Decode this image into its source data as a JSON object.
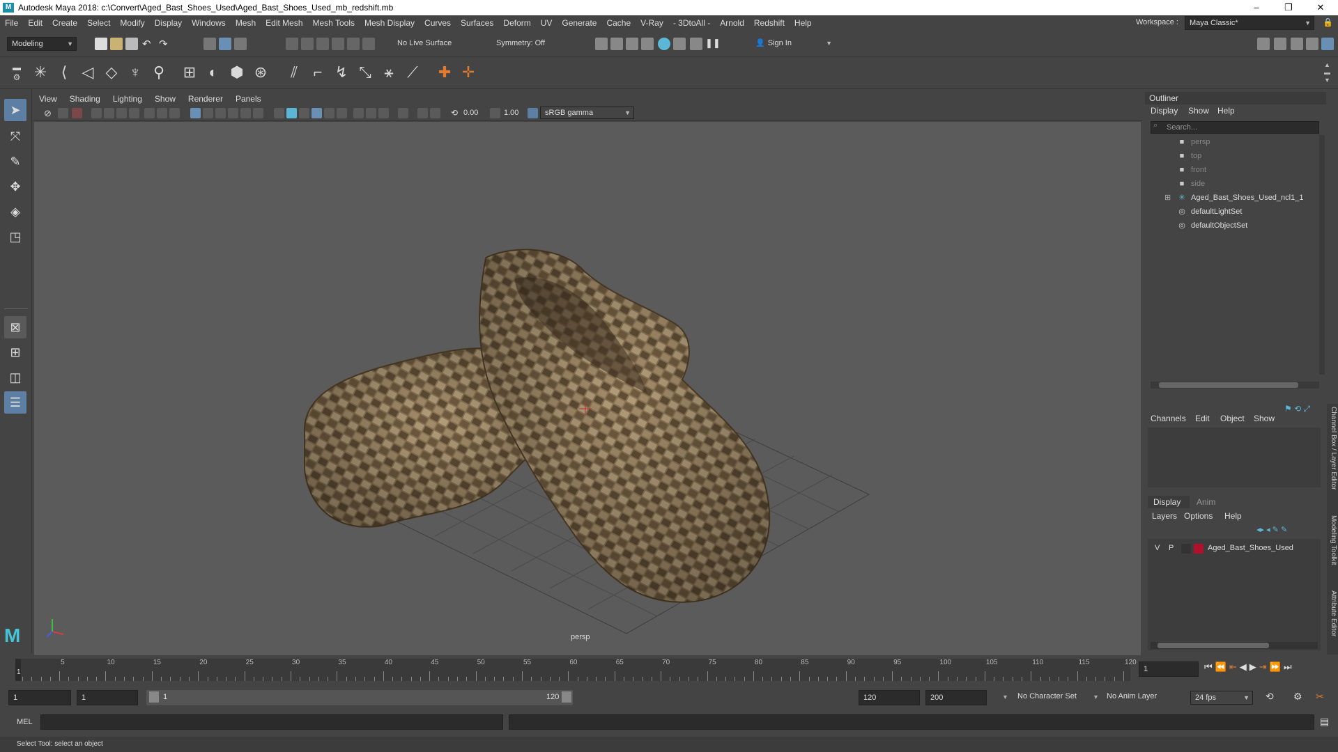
{
  "title": "Autodesk Maya 2018: c:\\Convert\\Aged_Bast_Shoes_Used\\Aged_Bast_Shoes_Used_mb_redshift.mb",
  "window_controls": [
    "–",
    "❐",
    "✕"
  ],
  "menu": [
    "File",
    "Edit",
    "Create",
    "Select",
    "Modify",
    "Display",
    "Windows",
    "Mesh",
    "Edit Mesh",
    "Mesh Tools",
    "Mesh Display",
    "Curves",
    "Surfaces",
    "Deform",
    "UV",
    "Generate",
    "Cache",
    "V-Ray",
    "- 3DtoAll -",
    "Arnold",
    "Redshift",
    "Help"
  ],
  "workspace": {
    "label": "Workspace :",
    "value": "Maya Classic*"
  },
  "status": {
    "mode": "Modeling",
    "live_surface": "No Live Surface",
    "symmetry": "Symmetry: Off",
    "sign_in": "Sign In"
  },
  "viewport": {
    "menu": [
      "View",
      "Shading",
      "Lighting",
      "Show",
      "Renderer",
      "Panels"
    ],
    "exposure": "0.00",
    "gamma": "1.00",
    "color_space": "sRGB gamma",
    "camera_label": "persp"
  },
  "outliner": {
    "title": "Outliner",
    "menu": [
      "Display",
      "Show",
      "Help"
    ],
    "search_placeholder": "Search...",
    "items": [
      {
        "label": "persp",
        "icon": "camera-icon",
        "dim": true
      },
      {
        "label": "top",
        "icon": "camera-icon",
        "dim": true
      },
      {
        "label": "front",
        "icon": "camera-icon",
        "dim": true
      },
      {
        "label": "side",
        "icon": "camera-icon",
        "dim": true
      },
      {
        "label": "Aged_Bast_Shoes_Used_ncl1_1",
        "icon": "transform-icon",
        "dim": false,
        "expandable": true
      },
      {
        "label": "defaultLightSet",
        "icon": "set-icon",
        "dim": false
      },
      {
        "label": "defaultObjectSet",
        "icon": "set-icon",
        "dim": false
      }
    ]
  },
  "channel_box": {
    "menu": [
      "Channels",
      "Edit",
      "Object",
      "Show"
    ]
  },
  "layer_editor": {
    "tabs": [
      "Display",
      "Anim"
    ],
    "menu": [
      "Layers",
      "Options",
      "Help"
    ],
    "layer": {
      "v": "V",
      "p": "P",
      "name": "Aged_Bast_Shoes_Used",
      "color": "#b0102a"
    }
  },
  "side_tabs": [
    "Channel Box / Layer Editor",
    "Modeling Toolkit",
    "Attribute Editor"
  ],
  "timeline": {
    "labels": [
      "5",
      "10",
      "15",
      "20",
      "25",
      "30",
      "35",
      "40",
      "45",
      "50",
      "55",
      "60",
      "65",
      "70",
      "75",
      "80",
      "85",
      "90",
      "95",
      "100",
      "105",
      "110",
      "115",
      "120"
    ],
    "current_frame": "1",
    "frame_field": "1"
  },
  "range": {
    "start": "1",
    "playback_start": "1",
    "slider_start": "1",
    "slider_end": "120",
    "playback_end": "120",
    "end": "200",
    "character_set": "No Character Set",
    "anim_layer": "No Anim Layer",
    "fps": "24 fps"
  },
  "command": {
    "lang": "MEL"
  },
  "help_line": "Select Tool: select an object"
}
